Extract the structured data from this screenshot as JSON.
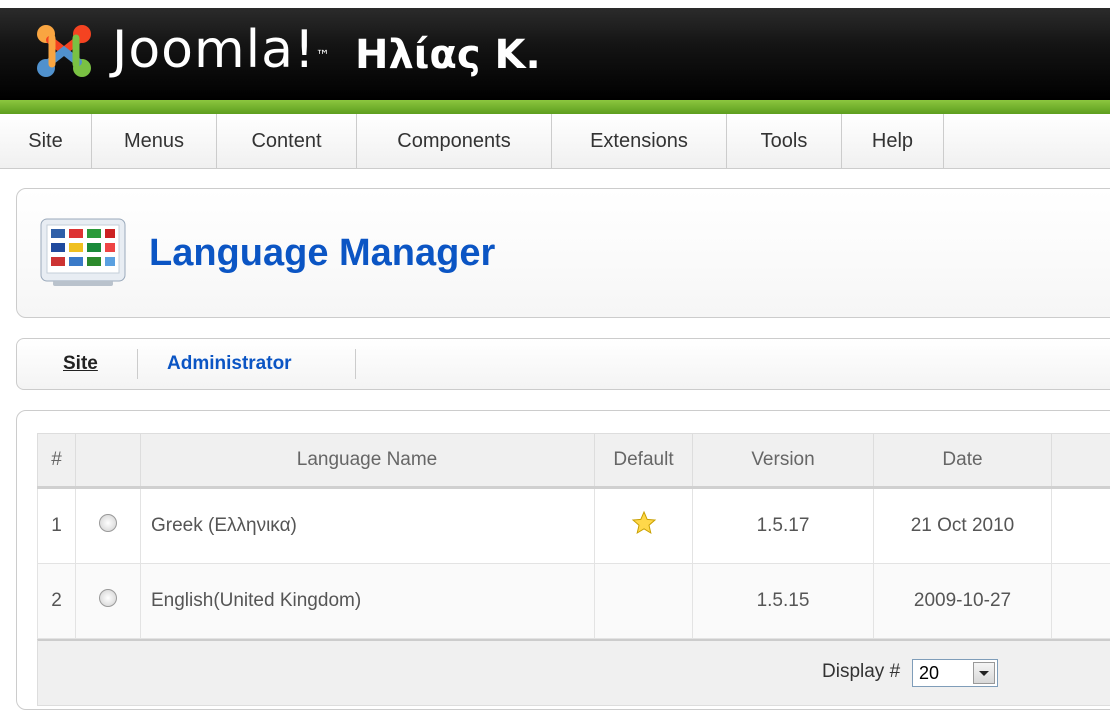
{
  "header": {
    "logo_text": "Joomla!",
    "site_name": "Ηλίας Κ."
  },
  "menu": {
    "items": [
      "Site",
      "Menus",
      "Content",
      "Components",
      "Extensions",
      "Tools",
      "Help"
    ]
  },
  "page": {
    "title": "Language Manager",
    "icon": "flags-icon"
  },
  "subtabs": {
    "site": "Site",
    "administrator": "Administrator",
    "active": "Site"
  },
  "table": {
    "columns": [
      "#",
      "",
      "Language Name",
      "Default",
      "Version",
      "Date"
    ],
    "rows": [
      {
        "num": "1",
        "name": "Greek (Ελληνικα)",
        "default": true,
        "version": "1.5.17",
        "date": "21 Oct 2010"
      },
      {
        "num": "2",
        "name": "English(United Kingdom)",
        "default": false,
        "version": "1.5.15",
        "date": "2009-10-27"
      }
    ]
  },
  "pagination": {
    "display_label": "Display #",
    "display_value": "20"
  },
  "colors": {
    "accent_green": "#6db33f",
    "title_blue": "#0b55c4",
    "header_black": "#000000"
  }
}
